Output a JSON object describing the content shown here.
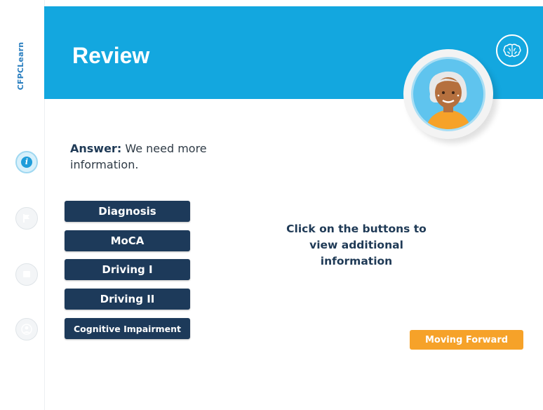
{
  "brand": {
    "name": "CFPCLearn",
    "color": "#2b7fc0"
  },
  "header": {
    "title": "Review",
    "bg_color": "#13a7df"
  },
  "sidebar": {
    "items": [
      {
        "name": "info-icon",
        "glyph": "i"
      },
      {
        "name": "flag-icon"
      },
      {
        "name": "message-icon"
      },
      {
        "name": "profile-icon"
      }
    ]
  },
  "answer": {
    "label": "Answer:",
    "text": "We need more information."
  },
  "buttons": [
    {
      "label": "Diagnosis"
    },
    {
      "label": "MoCA"
    },
    {
      "label": "Driving I"
    },
    {
      "label": "Driving II"
    },
    {
      "label": "Cognitive Impairment"
    }
  ],
  "prompt": "Click on the buttons to view additional information",
  "forward": {
    "label": "Moving Forward",
    "color": "#f6a229"
  },
  "colors": {
    "button_navy": "#1d3a5a",
    "accent_blue": "#1f9dda"
  }
}
